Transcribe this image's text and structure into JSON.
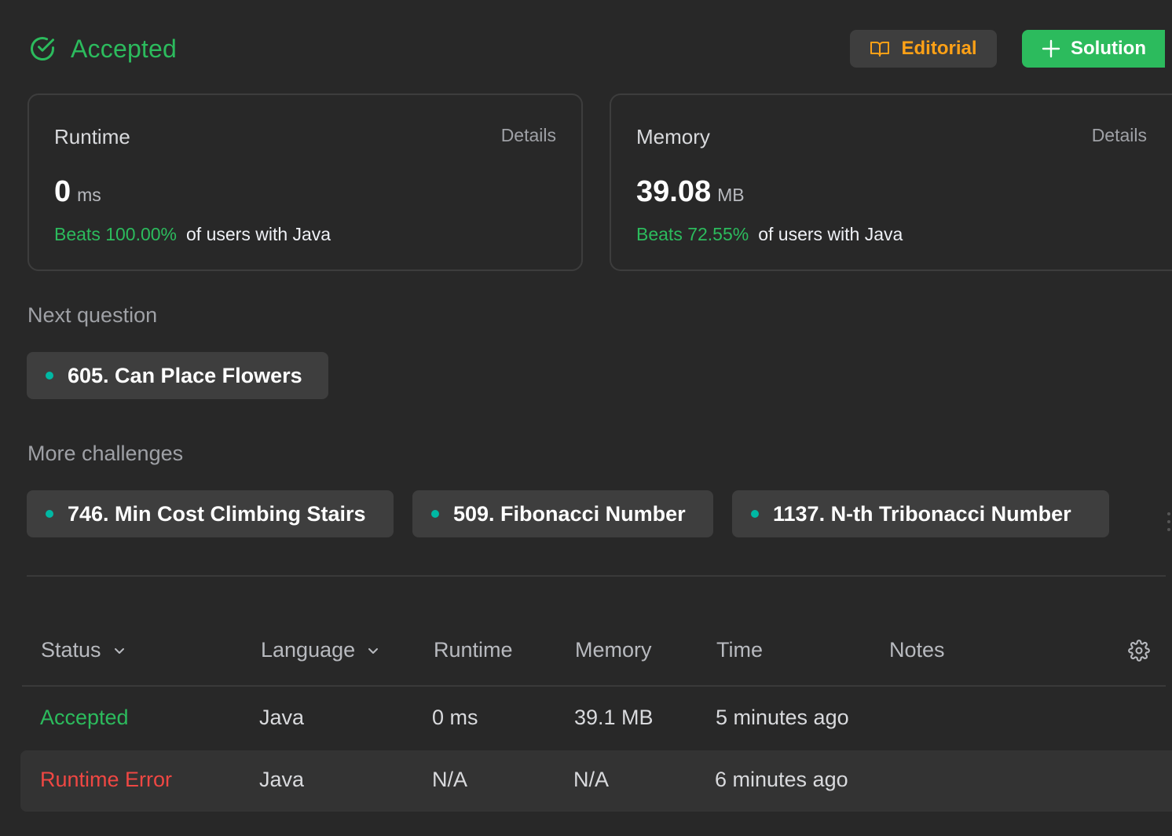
{
  "header": {
    "status": "Accepted",
    "editorial_label": "Editorial",
    "solution_label": "Solution"
  },
  "runtime_card": {
    "title": "Runtime",
    "details": "Details",
    "value": "0",
    "unit": "ms",
    "beats": "Beats 100.00%",
    "beats_suffix": "of users with Java"
  },
  "memory_card": {
    "title": "Memory",
    "details": "Details",
    "value": "39.08",
    "unit": "MB",
    "beats": "Beats 72.55%",
    "beats_suffix": "of users with Java"
  },
  "next_question": {
    "label": "Next question",
    "items": [
      {
        "title": "605. Can Place Flowers"
      }
    ]
  },
  "more_challenges": {
    "label": "More challenges",
    "items": [
      {
        "title": "746. Min Cost Climbing Stairs"
      },
      {
        "title": "509. Fibonacci Number"
      },
      {
        "title": "1137. N-th Tribonacci Number"
      }
    ]
  },
  "table": {
    "headers": {
      "status": "Status",
      "language": "Language",
      "runtime": "Runtime",
      "memory": "Memory",
      "time": "Time",
      "notes": "Notes"
    },
    "rows": [
      {
        "status": "Accepted",
        "language": "Java",
        "runtime": "0 ms",
        "memory": "39.1 MB",
        "time": "5 minutes ago",
        "notes": ""
      },
      {
        "status": "Runtime Error",
        "language": "Java",
        "runtime": "N/A",
        "memory": "N/A",
        "time": "6 minutes ago",
        "notes": ""
      }
    ]
  },
  "colors": {
    "accent_green": "#2cbb5d",
    "accent_orange": "#ffa116",
    "error_red": "#ef4743",
    "teal_dot": "#00b8a3",
    "background": "#282828"
  },
  "icons": {
    "status": "check-circle-icon",
    "editorial": "open-book-icon",
    "solution": "plus-icon",
    "dropdown": "chevron-down-icon",
    "settings": "gear-icon"
  }
}
